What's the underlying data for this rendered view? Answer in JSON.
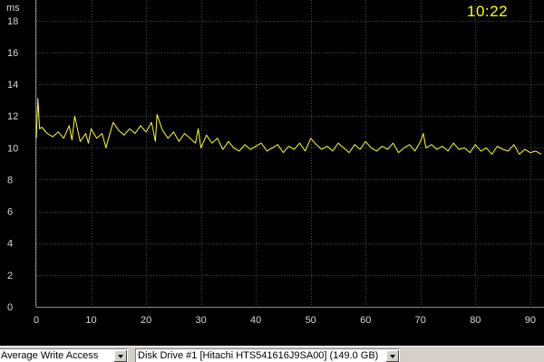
{
  "chart_header": {
    "unit_label": "ms",
    "clock": "10:22"
  },
  "chart_data": {
    "type": "line",
    "y_ticks": [
      "0",
      "2",
      "4",
      "6",
      "8",
      "10",
      "12",
      "14",
      "16",
      "18"
    ],
    "x_ticks": [
      "0",
      "10",
      "20",
      "30",
      "40",
      "50",
      "60",
      "70",
      "80",
      "90"
    ],
    "ylim": [
      0,
      19.3
    ],
    "xlim": [
      0,
      92.5
    ],
    "grid": true,
    "series_color": "#ffff33",
    "grid_color": "#4a4a4a",
    "series": [
      {
        "x": [
          0,
          0.3,
          0.6,
          1,
          2,
          3,
          4,
          5,
          6,
          6.5,
          7,
          8,
          9,
          9.5,
          10,
          11,
          12,
          12.7,
          13,
          14,
          15,
          16,
          17,
          18,
          19,
          20,
          21,
          21.7,
          22,
          23,
          24,
          25,
          26,
          27,
          28,
          29,
          29.5,
          30,
          31,
          32,
          33,
          34,
          35,
          36,
          37,
          38,
          39,
          40,
          41,
          42,
          43,
          44,
          45,
          46,
          47,
          48,
          49,
          50,
          51,
          52,
          53,
          54,
          55,
          56,
          57,
          58,
          59,
          60,
          61,
          62,
          63,
          64,
          65,
          66,
          67,
          68,
          69,
          70,
          70.5,
          71,
          72,
          73,
          74,
          75,
          76,
          77,
          78,
          79,
          80,
          81,
          82,
          83,
          84,
          85,
          86,
          87,
          88,
          89,
          90,
          91,
          92
        ],
        "values": [
          10.6,
          13.1,
          11.2,
          11.3,
          10.9,
          10.7,
          11.0,
          10.6,
          11.4,
          10.5,
          12.0,
          10.4,
          10.9,
          10.3,
          11.2,
          10.6,
          10.9,
          10.0,
          10.4,
          11.6,
          11.1,
          10.8,
          11.2,
          10.9,
          11.4,
          11.0,
          11.6,
          10.4,
          12.1,
          11.1,
          10.6,
          11.0,
          10.4,
          10.9,
          10.6,
          10.3,
          11.2,
          10.0,
          10.8,
          10.3,
          10.6,
          9.9,
          10.4,
          10.0,
          9.8,
          10.2,
          9.9,
          10.1,
          10.3,
          9.8,
          10.0,
          10.2,
          9.7,
          10.1,
          9.9,
          10.3,
          9.8,
          10.6,
          10.2,
          9.9,
          10.1,
          9.8,
          10.3,
          10.0,
          9.7,
          10.2,
          9.9,
          10.4,
          10.0,
          9.8,
          10.1,
          9.9,
          10.3,
          9.7,
          10.0,
          10.2,
          9.8,
          10.4,
          10.9,
          10.0,
          10.2,
          9.9,
          10.1,
          9.8,
          10.3,
          9.9,
          10.0,
          9.7,
          10.2,
          9.8,
          10.0,
          9.6,
          10.1,
          9.9,
          9.8,
          10.2,
          9.6,
          9.9,
          9.7,
          9.8,
          9.6
        ]
      }
    ]
  },
  "toolbar": {
    "metric_select": "Average Write Access",
    "drive_select": "Disk Drive #1  [Hitachi HTS541616J9SA00]  (149.0 GB)"
  }
}
